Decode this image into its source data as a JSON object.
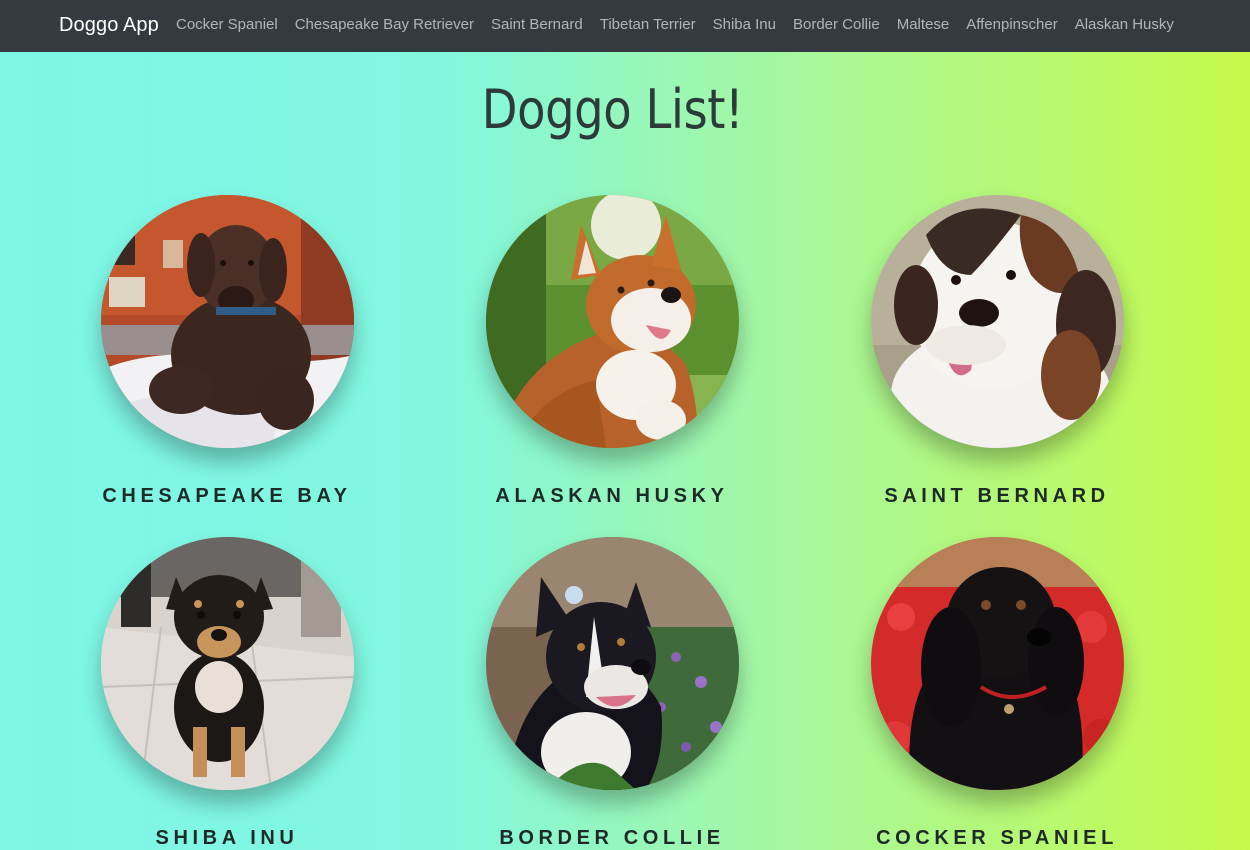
{
  "navbar": {
    "brand": "Doggo App",
    "links": [
      "Cocker Spaniel",
      "Chesapeake Bay Retriever",
      "Saint Bernard",
      "Tibetan Terrier",
      "Shiba Inu",
      "Border Collie",
      "Maltese",
      "Affenpinscher",
      "Alaskan Husky"
    ]
  },
  "main": {
    "title": "Doggo List!",
    "dogs": [
      {
        "name": "CHESAPEAKE BAY",
        "photo": "chesapeake-bay-photo"
      },
      {
        "name": "ALASKAN HUSKY",
        "photo": "alaskan-husky-photo"
      },
      {
        "name": "SAINT BERNARD",
        "photo": "saint-bernard-photo"
      },
      {
        "name": "SHIBA INU",
        "photo": "shiba-inu-photo"
      },
      {
        "name": "BORDER COLLIE",
        "photo": "border-collie-photo"
      },
      {
        "name": "COCKER SPANIEL",
        "photo": "cocker-spaniel-photo"
      }
    ]
  },
  "colors": {
    "navbar_bg": "#343a40",
    "gradient_start": "#7ef6e8",
    "gradient_end": "#c6fa4a"
  }
}
